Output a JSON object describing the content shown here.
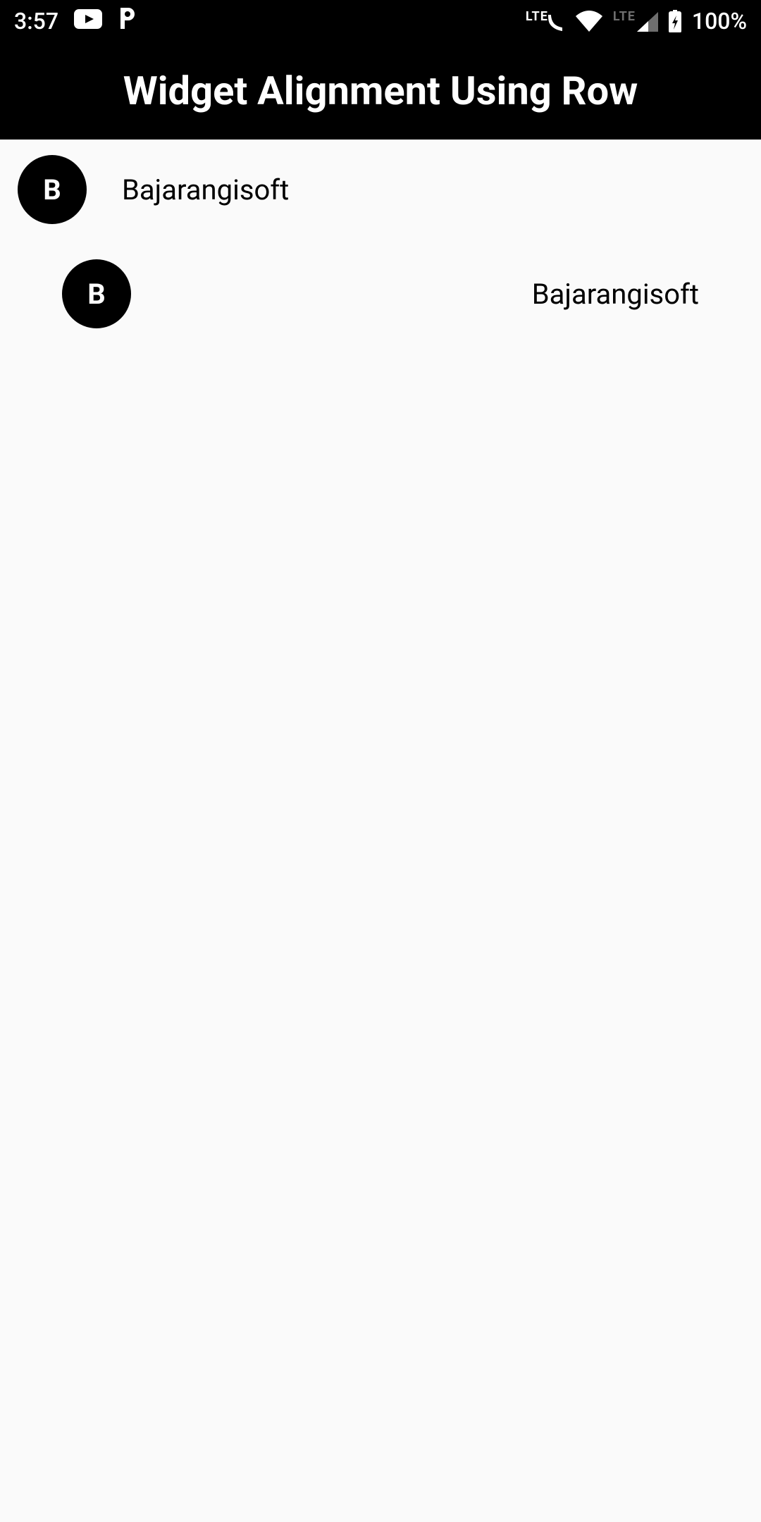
{
  "status": {
    "time": "3:57",
    "battery_pct": "100%",
    "lte1": "LTE",
    "lte2": "LTE"
  },
  "appbar": {
    "title": "Widget Alignment Using Row"
  },
  "rows": [
    {
      "avatar_letter": "B",
      "label": "Bajarangisoft"
    },
    {
      "avatar_letter": "B",
      "label": "Bajarangisoft"
    }
  ]
}
